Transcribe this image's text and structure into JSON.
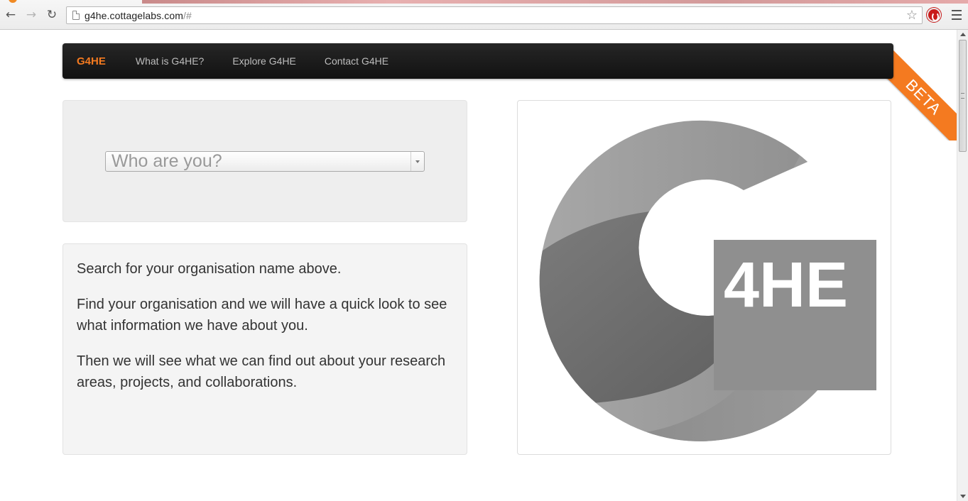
{
  "browser": {
    "url_host": "g4he.cottagelabs.com",
    "url_path": "/#",
    "icons": [
      "back-icon",
      "forward-icon",
      "reload-icon",
      "page-icon",
      "star-icon",
      "extension-icon",
      "menu-icon"
    ],
    "back_glyph": "←",
    "forward_glyph": "→",
    "reload_glyph": "↻",
    "star_glyph": "☆"
  },
  "ribbon": {
    "label": "BETA",
    "color": "#f47a20"
  },
  "navbar": {
    "brand": "G4HE",
    "links": [
      "What is G4HE?",
      "Explore G4HE",
      "Contact G4HE"
    ]
  },
  "select": {
    "placeholder": "Who are you?"
  },
  "info": {
    "paragraphs": [
      "Search for your organisation name above.",
      "Find your organisation and we will have a quick look to see what information we have about you.",
      "Then we will see what we can find out about your research areas, projects, and collaborations."
    ]
  },
  "logo": {
    "text": "4HE"
  },
  "colors": {
    "accent": "#f47a20",
    "navbar": "#1a1a1a"
  }
}
